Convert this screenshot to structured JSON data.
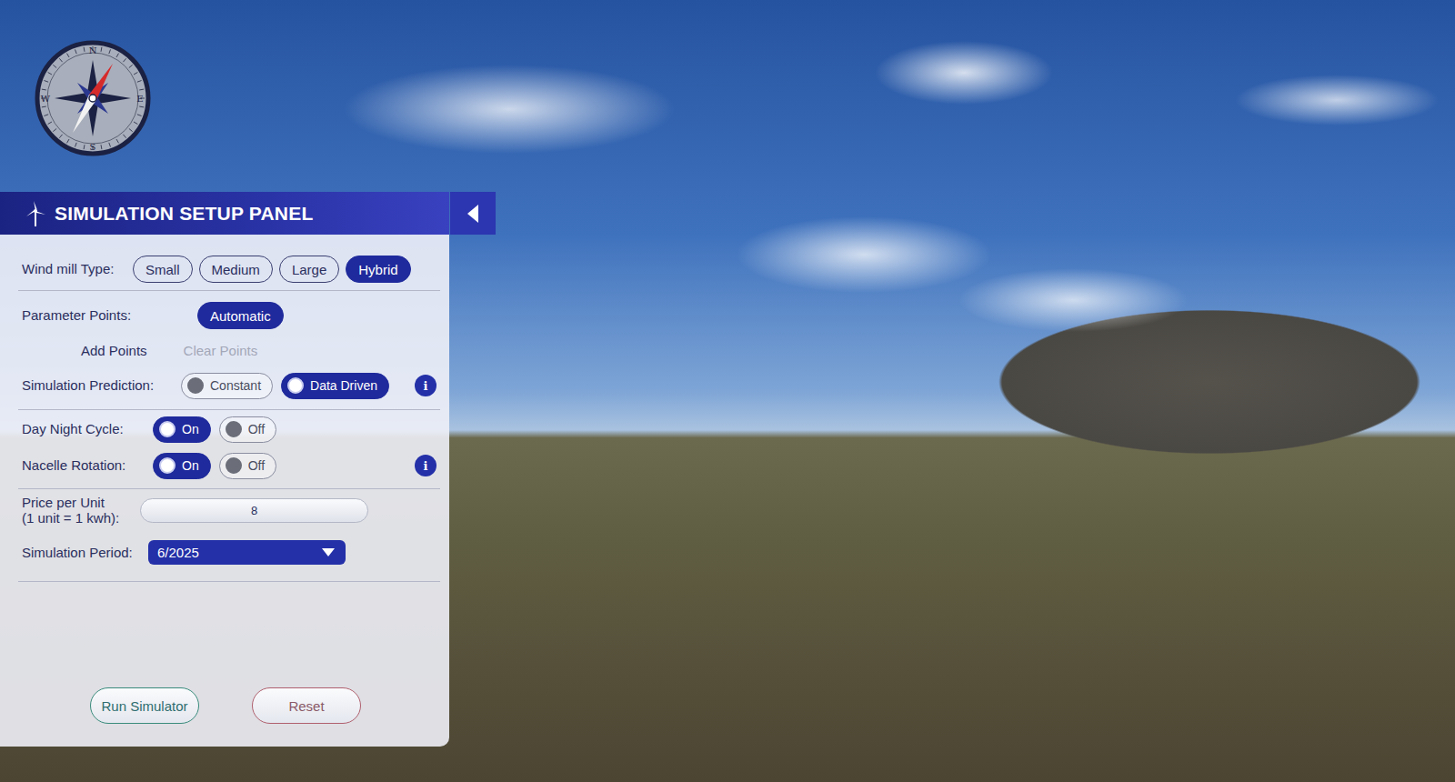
{
  "compass": {
    "north": "N",
    "east": "E",
    "south": "S",
    "west": "W"
  },
  "panel": {
    "title": "SIMULATION SETUP PANEL",
    "expanded": true
  },
  "windmill_type": {
    "label": "Wind mill Type:",
    "options": [
      {
        "label": "Small",
        "selected": false
      },
      {
        "label": "Medium",
        "selected": false
      },
      {
        "label": "Large",
        "selected": false
      },
      {
        "label": "Hybrid",
        "selected": true
      }
    ]
  },
  "parameter_points": {
    "label": "Parameter Points:",
    "options": [
      {
        "label": "Automatic",
        "selected": true
      }
    ]
  },
  "point_actions": [
    {
      "label": "Add Points",
      "disabled": false
    },
    {
      "label": "Clear Points",
      "disabled": true
    }
  ],
  "simulation_prediction": {
    "label": "Simulation Prediction:",
    "options": [
      {
        "label": "Constant",
        "selected": false
      },
      {
        "label": "Data Driven",
        "selected": true
      }
    ],
    "info": "i"
  },
  "day_night_cycle": {
    "label": "Day Night Cycle:",
    "options": [
      {
        "label": "On",
        "selected": true
      },
      {
        "label": "Off",
        "selected": false
      }
    ]
  },
  "nacelle_rotation": {
    "label": "Nacelle Rotation:",
    "options": [
      {
        "label": "On",
        "selected": true
      },
      {
        "label": "Off",
        "selected": false
      }
    ],
    "info": "i"
  },
  "price_per_unit": {
    "label_lines": [
      "Price per Unit",
      "(1 unit = 1 kwh):"
    ],
    "value": "8"
  },
  "simulation_period": {
    "label": "Simulation Period:",
    "value": "6/2025"
  },
  "buttons": [
    {
      "label": "Run Simulator",
      "kind": "primary"
    },
    {
      "label": "Reset",
      "kind": "danger"
    }
  ]
}
